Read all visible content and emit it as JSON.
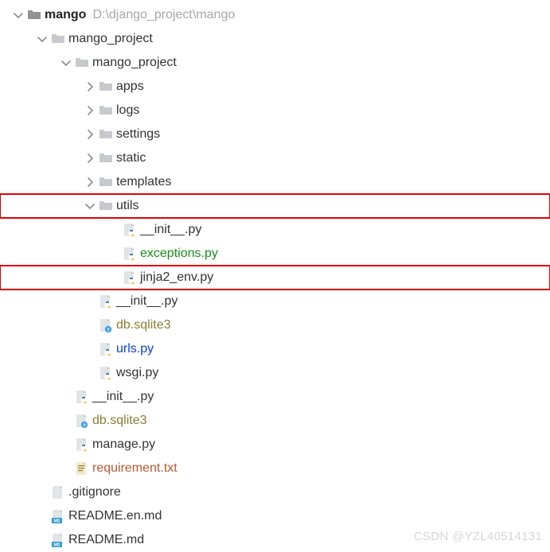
{
  "root": {
    "name": "mango",
    "path": "D:\\django_project\\mango"
  },
  "nodes": [
    {
      "depth": 0,
      "expand": "open",
      "kind": "folder",
      "label": "mango_project"
    },
    {
      "depth": 1,
      "expand": "open",
      "kind": "folder",
      "label": "mango_project"
    },
    {
      "depth": 2,
      "expand": "closed",
      "kind": "folder",
      "label": "apps"
    },
    {
      "depth": 2,
      "expand": "closed",
      "kind": "folder",
      "label": "logs"
    },
    {
      "depth": 2,
      "expand": "closed",
      "kind": "folder",
      "label": "settings"
    },
    {
      "depth": 2,
      "expand": "closed",
      "kind": "folder",
      "label": "static"
    },
    {
      "depth": 2,
      "expand": "closed",
      "kind": "folder",
      "label": "templates"
    },
    {
      "depth": 2,
      "expand": "open",
      "kind": "folder",
      "label": "utils",
      "highlight": true
    },
    {
      "depth": 3,
      "expand": "none",
      "kind": "py",
      "label": "__init__.py"
    },
    {
      "depth": 3,
      "expand": "none",
      "kind": "py",
      "label": "exceptions.py",
      "color": "green"
    },
    {
      "depth": 3,
      "expand": "none",
      "kind": "py",
      "label": "jinja2_env.py",
      "highlight": true
    },
    {
      "depth": 2,
      "expand": "none",
      "kind": "py",
      "label": "__init__.py"
    },
    {
      "depth": 2,
      "expand": "none",
      "kind": "unk",
      "label": "db.sqlite3",
      "color": "olive"
    },
    {
      "depth": 2,
      "expand": "none",
      "kind": "py",
      "label": "urls.py",
      "color": "blue"
    },
    {
      "depth": 2,
      "expand": "none",
      "kind": "py",
      "label": "wsgi.py"
    },
    {
      "depth": 1,
      "expand": "none",
      "kind": "py",
      "label": "__init__.py"
    },
    {
      "depth": 1,
      "expand": "none",
      "kind": "unk",
      "label": "db.sqlite3",
      "color": "olive"
    },
    {
      "depth": 1,
      "expand": "none",
      "kind": "py",
      "label": "manage.py"
    },
    {
      "depth": 1,
      "expand": "none",
      "kind": "txt",
      "label": "requirement.txt",
      "color": "brown"
    },
    {
      "depth": 0,
      "expand": "none",
      "kind": "plain",
      "label": ".gitignore"
    },
    {
      "depth": 0,
      "expand": "none",
      "kind": "md",
      "label": "README.en.md"
    },
    {
      "depth": 0,
      "expand": "none",
      "kind": "md",
      "label": "README.md"
    }
  ],
  "watermark": "CSDN @YZL40514131"
}
